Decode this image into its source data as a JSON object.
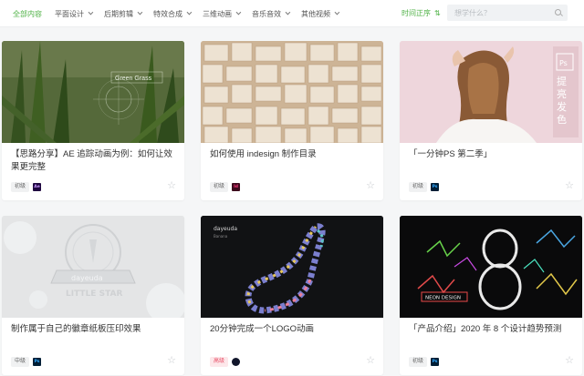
{
  "nav": {
    "items": [
      {
        "label": "全部内容",
        "active": true,
        "dropdown": false
      },
      {
        "label": "平面设计",
        "active": false,
        "dropdown": true
      },
      {
        "label": "后期剪辑",
        "active": false,
        "dropdown": true
      },
      {
        "label": "特效合成",
        "active": false,
        "dropdown": true
      },
      {
        "label": "三维动画",
        "active": false,
        "dropdown": true
      },
      {
        "label": "音乐音效",
        "active": false,
        "dropdown": true
      },
      {
        "label": "其他视频",
        "active": false,
        "dropdown": true
      }
    ],
    "sort_label": "时间正序",
    "sort_icon": "⇅"
  },
  "search": {
    "placeholder": "想学什么？"
  },
  "colors": {
    "accent": "#4fb246",
    "background": "#f5f6f7"
  },
  "cards": [
    {
      "title": "【思路分享】AE 追踪动画为例：如何让效果更完整",
      "level": "初级",
      "app": "Ae",
      "thumb_text": "Green Grass"
    },
    {
      "title": "如何使用 indesign 制作目录",
      "level": "初级",
      "app": "Id",
      "thumb_text": ""
    },
    {
      "title": "「一分钟PS 第二季」",
      "level": "初级",
      "app": "Ps",
      "thumb_text": "提亮发色"
    },
    {
      "title": "制作属于自己的徽章纸板压印效果",
      "level": "中级",
      "app": "Ps",
      "thumb_text": "dayeuda LITTLE STAR"
    },
    {
      "title": "20分钟完成一个LOGO动画",
      "level": "高级",
      "app": "C4D",
      "thumb_text": "dayeuda"
    },
    {
      "title": "「产品介绍」2020 年 8 个设计趋势预测",
      "level": "初级",
      "app": "Ps",
      "thumb_text": "NEON DESIGN"
    }
  ]
}
